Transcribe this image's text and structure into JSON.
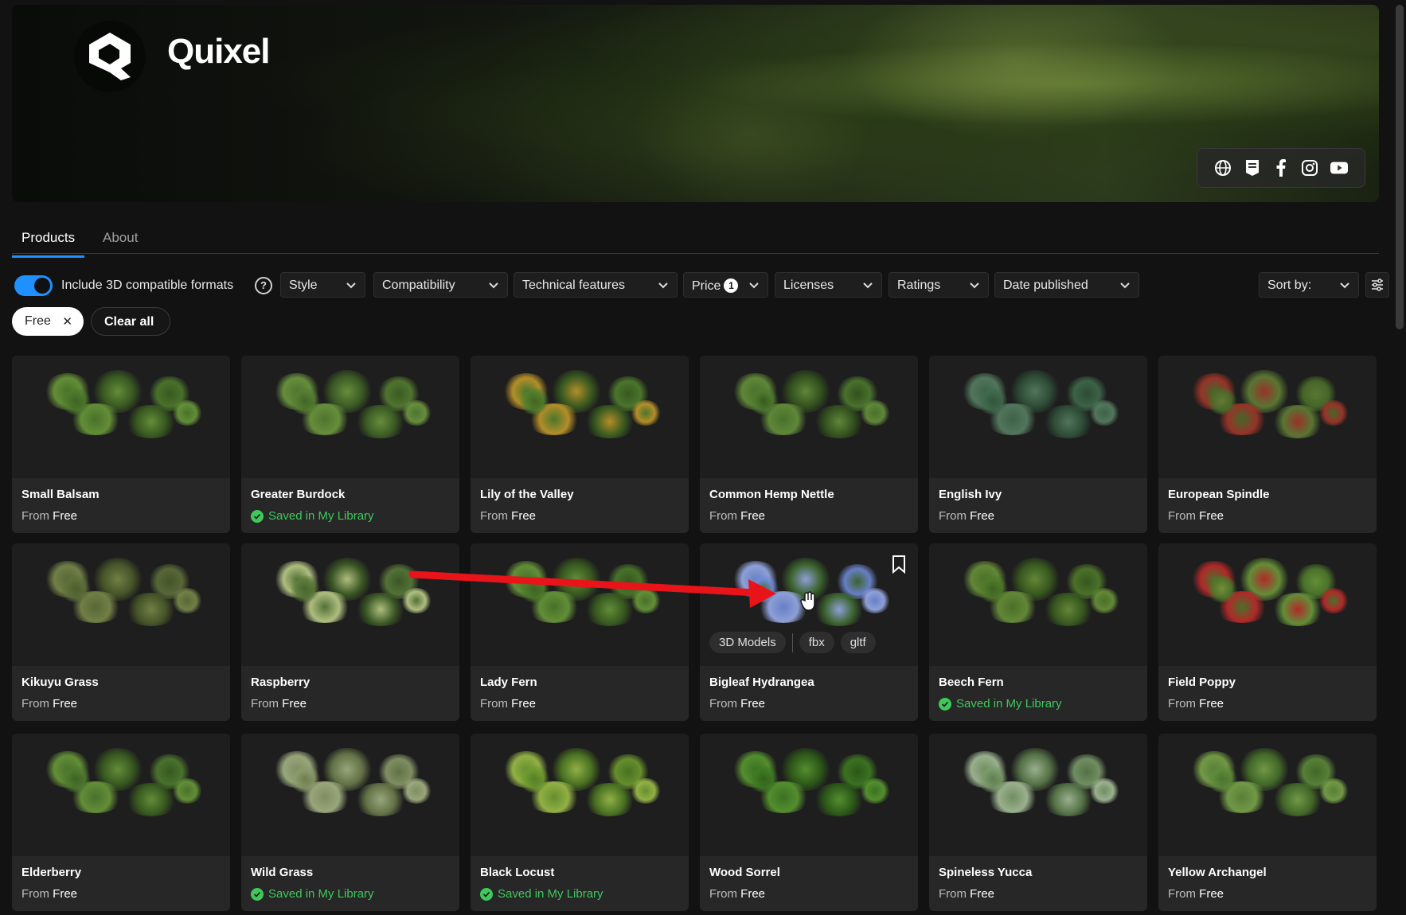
{
  "brand": {
    "name": "Quixel"
  },
  "social": [
    "globe-icon",
    "epic-games-icon",
    "facebook-icon",
    "instagram-icon",
    "youtube-icon"
  ],
  "tabs": [
    {
      "label": "Products",
      "active": true
    },
    {
      "label": "About",
      "active": false
    }
  ],
  "filters": {
    "toggle_label": "Include 3D compatible formats",
    "toggle_on": true,
    "dropdowns": [
      {
        "label": "Style"
      },
      {
        "label": "Compatibility"
      },
      {
        "label": "Technical features"
      },
      {
        "label": "Price",
        "badge": "1"
      },
      {
        "label": "Licenses"
      },
      {
        "label": "Ratings"
      },
      {
        "label": "Date published"
      }
    ],
    "sort_label": "Sort by:"
  },
  "chips": {
    "active_filter": "Free",
    "clear_label": "Clear all"
  },
  "price_prefix": "From",
  "saved_label": "Saved in My Library",
  "products": [
    {
      "title": "Small Balsam",
      "price": "Free",
      "saved": false
    },
    {
      "title": "Greater Burdock",
      "price": "Free",
      "saved": true
    },
    {
      "title": "Lily of the Valley",
      "price": "Free",
      "saved": false
    },
    {
      "title": "Common Hemp Nettle",
      "price": "Free",
      "saved": false
    },
    {
      "title": "English Ivy",
      "price": "Free",
      "saved": false
    },
    {
      "title": "European Spindle",
      "price": "Free",
      "saved": false
    },
    {
      "title": "Kikuyu Grass",
      "price": "Free",
      "saved": false
    },
    {
      "title": "Raspberry",
      "price": "Free",
      "saved": false
    },
    {
      "title": "Lady Fern",
      "price": "Free",
      "saved": false
    },
    {
      "title": "Bigleaf Hydrangea",
      "price": "Free",
      "saved": false,
      "hovered": true,
      "tags": [
        "3D Models",
        "fbx",
        "gltf"
      ]
    },
    {
      "title": "Beech Fern",
      "price": "Free",
      "saved": true
    },
    {
      "title": "Field Poppy",
      "price": "Free",
      "saved": false
    },
    {
      "title": "Elderberry",
      "price": "Free",
      "saved": false
    },
    {
      "title": "Wild Grass",
      "price": "Free",
      "saved": true
    },
    {
      "title": "Black Locust",
      "price": "Free",
      "saved": true
    },
    {
      "title": "Wood Sorrel",
      "price": "Free",
      "saved": false
    },
    {
      "title": "Spineless Yucca",
      "price": "Free",
      "saved": false
    },
    {
      "title": "Yellow Archangel",
      "price": "Free",
      "saved": false
    }
  ],
  "colors": {
    "accent": "#1e90ff",
    "saved": "#3ec95a",
    "annotation": "#e8141a"
  }
}
